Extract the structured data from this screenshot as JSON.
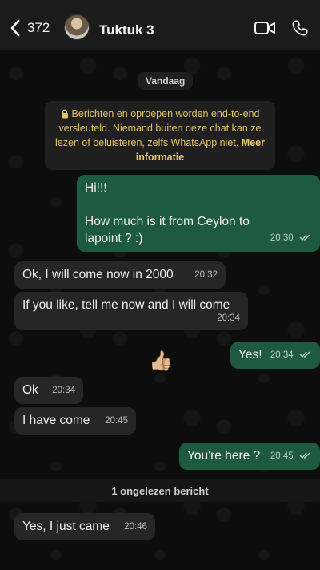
{
  "header": {
    "back_count": "372",
    "contact_name": "Tuktuk 3",
    "icons": {
      "back": "chevron-left-icon",
      "video": "video-call-icon",
      "phone": "phone-icon"
    }
  },
  "chat": {
    "date_label": "Vandaag",
    "encryption_notice": {
      "text": "Berichten en oproepen worden end-to-end versleuteld. Niemand buiten deze chat kan ze lezen of beluisteren, zelfs WhatsApp niet.",
      "link": "Meer informatie"
    },
    "messages": [
      {
        "dir": "out",
        "lines": [
          "Hi!!!",
          "",
          "How much is it from Ceylon to lapoint ? :)"
        ],
        "time": "20:30",
        "ticks": true
      },
      {
        "dir": "in",
        "text": "Ok, I will come now in 2000",
        "time": "20:32"
      },
      {
        "dir": "in",
        "text": "If you like, tell me now and I will come",
        "time": "20:34"
      },
      {
        "dir": "out",
        "text": "Yes!",
        "time": "20:34",
        "ticks": true
      },
      {
        "dir": "in",
        "text": "Ok",
        "time": "20:34"
      },
      {
        "dir": "in",
        "text": "I have come",
        "time": "20:45"
      },
      {
        "dir": "out",
        "text": "You're here ?",
        "time": "20:45",
        "ticks": true
      },
      {
        "dir": "in",
        "text": "Yes, I just came",
        "time": "20:46"
      }
    ],
    "reaction_emoji": "👍🏼",
    "unread_label": "1 ongelezen bericht"
  },
  "colors": {
    "incoming": "#262626",
    "outgoing": "#1e5a3f",
    "notice_text": "#e0c26a"
  }
}
